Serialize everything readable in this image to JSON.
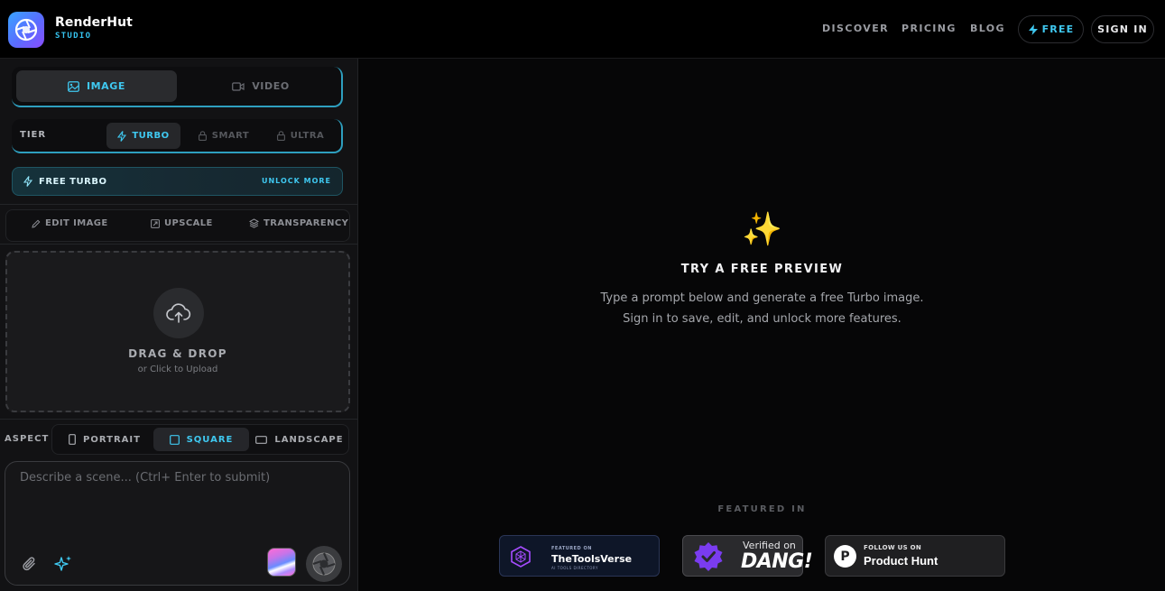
{
  "header": {
    "brand_name": "RenderHut",
    "brand_sub": "STUDIO",
    "nav": [
      "DISCOVER",
      "PRICING",
      "BLOG"
    ],
    "free_label": "FREE",
    "sign_in_label": "SIGN IN"
  },
  "mode": {
    "image_label": "IMAGE",
    "video_label": "VIDEO",
    "selected": "IMAGE"
  },
  "tier": {
    "label": "TIER",
    "options": [
      "TURBO",
      "SMART",
      "ULTRA"
    ],
    "selected": "TURBO"
  },
  "free_turbo": {
    "label": "FREE TURBO",
    "unlock_label": "UNLOCK MORE"
  },
  "tools": [
    "EDIT IMAGE",
    "UPSCALE",
    "TRANSPARENCY"
  ],
  "upload": {
    "title": "DRAG & DROP",
    "subtitle": "or Click to Upload"
  },
  "aspect": {
    "label": "ASPECT",
    "options": [
      "PORTRAIT",
      "SQUARE",
      "LANDSCAPE"
    ],
    "selected": "SQUARE"
  },
  "prompt": {
    "placeholder": "Describe a scene... (Ctrl+ Enter to submit)",
    "value": ""
  },
  "preview": {
    "icon": "✨",
    "title": "TRY A FREE PREVIEW",
    "line1": "Type a prompt below and generate a free Turbo image.",
    "line2": "Sign in to save, edit, and unlock more features."
  },
  "featured": {
    "label": "FEATURED IN",
    "toolsverse": {
      "small": "FEATURED ON",
      "name": "TheToolsVerse",
      "tag": "AI TOOLS DIRECTORY"
    },
    "dang": {
      "verified": "Verified on",
      "name": "DANG!"
    },
    "producthunt": {
      "letter": "P",
      "small": "FOLLOW US ON",
      "name": "Product Hunt"
    }
  },
  "colors": {
    "accent": "#3fc8f0",
    "background": "#070708",
    "panel": "#121214"
  }
}
